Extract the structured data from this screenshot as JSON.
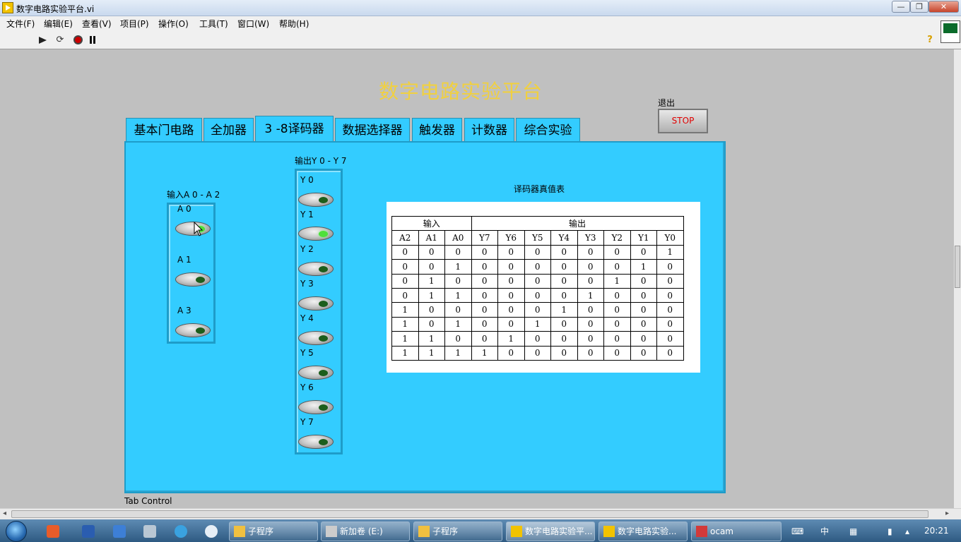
{
  "window": {
    "title": "数字电路实验平台.vi",
    "min": "—",
    "max": "❐",
    "close": "✕"
  },
  "menu": [
    "文件(F)",
    "编辑(E)",
    "查看(V)",
    "项目(P)",
    "操作(O)",
    "工具(T)",
    "窗口(W)",
    "帮助(H)"
  ],
  "toolbar": {
    "help": "?"
  },
  "panel": {
    "title": "数字电路实验平台",
    "exit_label": "退出",
    "stop_label": "STOP",
    "tab_control_label": "Tab Control",
    "tabs": [
      "基本门电路",
      "全加器",
      "3 -8译码器",
      "数据选择器",
      "触发器",
      "计数器",
      "综合实验"
    ],
    "active_tab": 2
  },
  "decoder": {
    "input_group_label": "输入A 0 - A 2",
    "inputs": [
      {
        "label": "A 0",
        "on": true
      },
      {
        "label": "A 1",
        "on": false
      },
      {
        "label": "A 3",
        "on": false
      }
    ],
    "output_group_label": "输出Y 0 - Y 7",
    "outputs": [
      {
        "label": "Y 0",
        "on": false
      },
      {
        "label": "Y 1",
        "on": true
      },
      {
        "label": "Y 2",
        "on": false
      },
      {
        "label": "Y 3",
        "on": false
      },
      {
        "label": "Y 4",
        "on": false
      },
      {
        "label": "Y 5",
        "on": false
      },
      {
        "label": "Y 6",
        "on": false
      },
      {
        "label": "Y 7",
        "on": false
      }
    ],
    "truth_table_title": "译码器真值表",
    "truth_table": {
      "group_headers": [
        "输入",
        "输出"
      ],
      "columns": [
        "A2",
        "A1",
        "A0",
        "Y7",
        "Y6",
        "Y5",
        "Y4",
        "Y3",
        "Y2",
        "Y1",
        "Y0"
      ],
      "rows": [
        [
          "0",
          "0",
          "0",
          "0",
          "0",
          "0",
          "0",
          "0",
          "0",
          "0",
          "1"
        ],
        [
          "0",
          "0",
          "1",
          "0",
          "0",
          "0",
          "0",
          "0",
          "0",
          "1",
          "0"
        ],
        [
          "0",
          "1",
          "0",
          "0",
          "0",
          "0",
          "0",
          "0",
          "1",
          "0",
          "0"
        ],
        [
          "0",
          "1",
          "1",
          "0",
          "0",
          "0",
          "0",
          "1",
          "0",
          "0",
          "0"
        ],
        [
          "1",
          "0",
          "0",
          "0",
          "0",
          "0",
          "1",
          "0",
          "0",
          "0",
          "0"
        ],
        [
          "1",
          "0",
          "1",
          "0",
          "0",
          "1",
          "0",
          "0",
          "0",
          "0",
          "0"
        ],
        [
          "1",
          "1",
          "0",
          "0",
          "1",
          "0",
          "0",
          "0",
          "0",
          "0",
          "0"
        ],
        [
          "1",
          "1",
          "1",
          "1",
          "0",
          "0",
          "0",
          "0",
          "0",
          "0",
          "0"
        ]
      ]
    }
  },
  "taskbar": {
    "buttons": [
      {
        "label": "子程序",
        "active": false
      },
      {
        "label": "新加卷 (E:)",
        "active": false
      },
      {
        "label": "子程序",
        "active": false
      },
      {
        "label": "数字电路实验平...",
        "active": true
      },
      {
        "label": "数字电路实验...",
        "active": false
      },
      {
        "label": "ocam",
        "active": false
      }
    ],
    "clock": "20:21",
    "ime": "中"
  }
}
